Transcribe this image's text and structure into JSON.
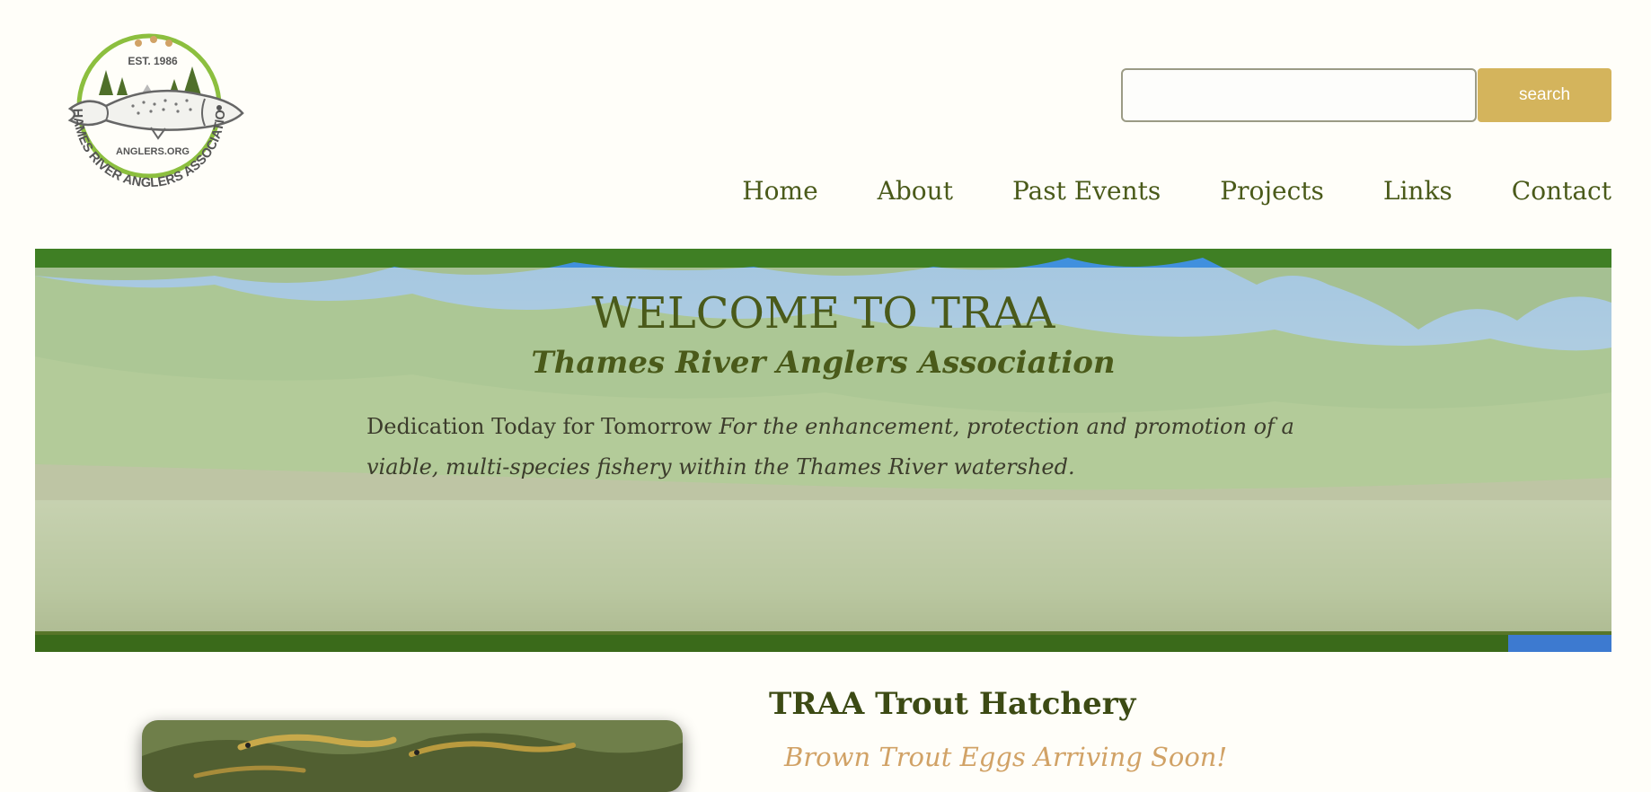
{
  "logo": {
    "est_text": "EST. 1986",
    "site_text": "ANGLERS.ORG",
    "ring_text": "THAMES RIVER ANGLERS ASSOCIATION"
  },
  "search": {
    "value": "",
    "placeholder": "",
    "button_label": "search"
  },
  "nav": {
    "items": [
      {
        "label": "Home"
      },
      {
        "label": "About"
      },
      {
        "label": "Past Events"
      },
      {
        "label": "Projects"
      },
      {
        "label": "Links"
      },
      {
        "label": "Contact"
      }
    ]
  },
  "hero": {
    "title": "WELCOME TO TRAA",
    "subtitle": "Thames River Anglers Association",
    "text_plain": "Dedication Today for Tomorrow",
    "text_italic": "For the enhancement, protection and promotion of a viable, multi-species fishery within the Thames River watershed."
  },
  "section": {
    "title": "TRAA Trout Hatchery",
    "subtitle": "Brown Trout Eggs Arriving Soon!"
  },
  "colors": {
    "brand_green": "#4a5a1a",
    "accent_gold": "#d4b45c",
    "logo_green": "#8cbf3f",
    "subtitle_tan": "#d1a266"
  },
  "icons": {
    "logo": "trout-logo-icon"
  }
}
